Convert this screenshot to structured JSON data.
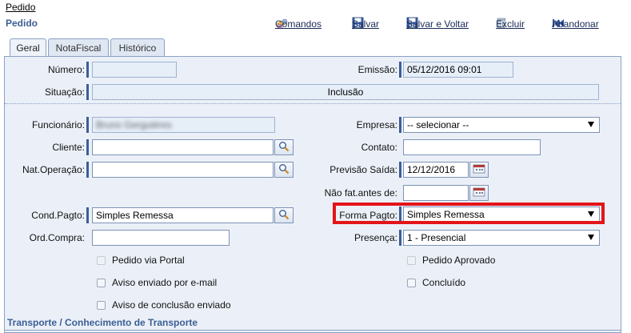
{
  "breadcrumb": "Pedido",
  "page_title": "Pedido",
  "toolbar": {
    "comandos": "Comandos",
    "salvar": "Salvar",
    "salvar_voltar": "Salvar e Voltar",
    "excluir": "Excluir",
    "abandonar": "Abandonar"
  },
  "tabs": [
    "Geral",
    "NotaFiscal",
    "Histórico"
  ],
  "form": {
    "numero_label": "Número:",
    "numero_value": "",
    "emissao_label": "Emissão:",
    "emissao_value": "05/12/2016 09:01",
    "situacao_label": "Situação:",
    "situacao_value": "Inclusão",
    "funcionario_label": "Funcionário:",
    "funcionario_value": "Bruno Gerguières",
    "empresa_label": "Empresa:",
    "empresa_value": "-- selecionar --",
    "cliente_label": "Cliente:",
    "cliente_value": "",
    "contato_label": "Contato:",
    "contato_value": "",
    "natop_label": "Nat.Operação:",
    "natop_value": "",
    "previsao_label": "Previsão Saída:",
    "previsao_value": "12/12/2016",
    "naofat_label": "Não fat.antes de:",
    "naofat_value": "",
    "condpagto_label": "Cond.Pagto:",
    "condpagto_value": "Simples Remessa",
    "formapagto_label": "Forma Pagto:",
    "formapagto_value": "Simples Remessa",
    "ordcompra_label": "Ord.Compra:",
    "ordcompra_value": "",
    "presenca_label": "Presença:",
    "presenca_value": "1 - Presencial"
  },
  "checkboxes": {
    "pedido_portal": "Pedido via Portal",
    "pedido_aprovado": "Pedido Aprovado",
    "aviso_email": "Aviso enviado por e-mail",
    "concluido": "Concluído",
    "aviso_conclusao": "Aviso de conclusão enviado"
  },
  "section_title": "Transporte / Conhecimento de Transporte",
  "colors": {
    "accent": "#3b5e95",
    "panel_bg": "#ebf0f8",
    "highlight": "#e3141a"
  }
}
